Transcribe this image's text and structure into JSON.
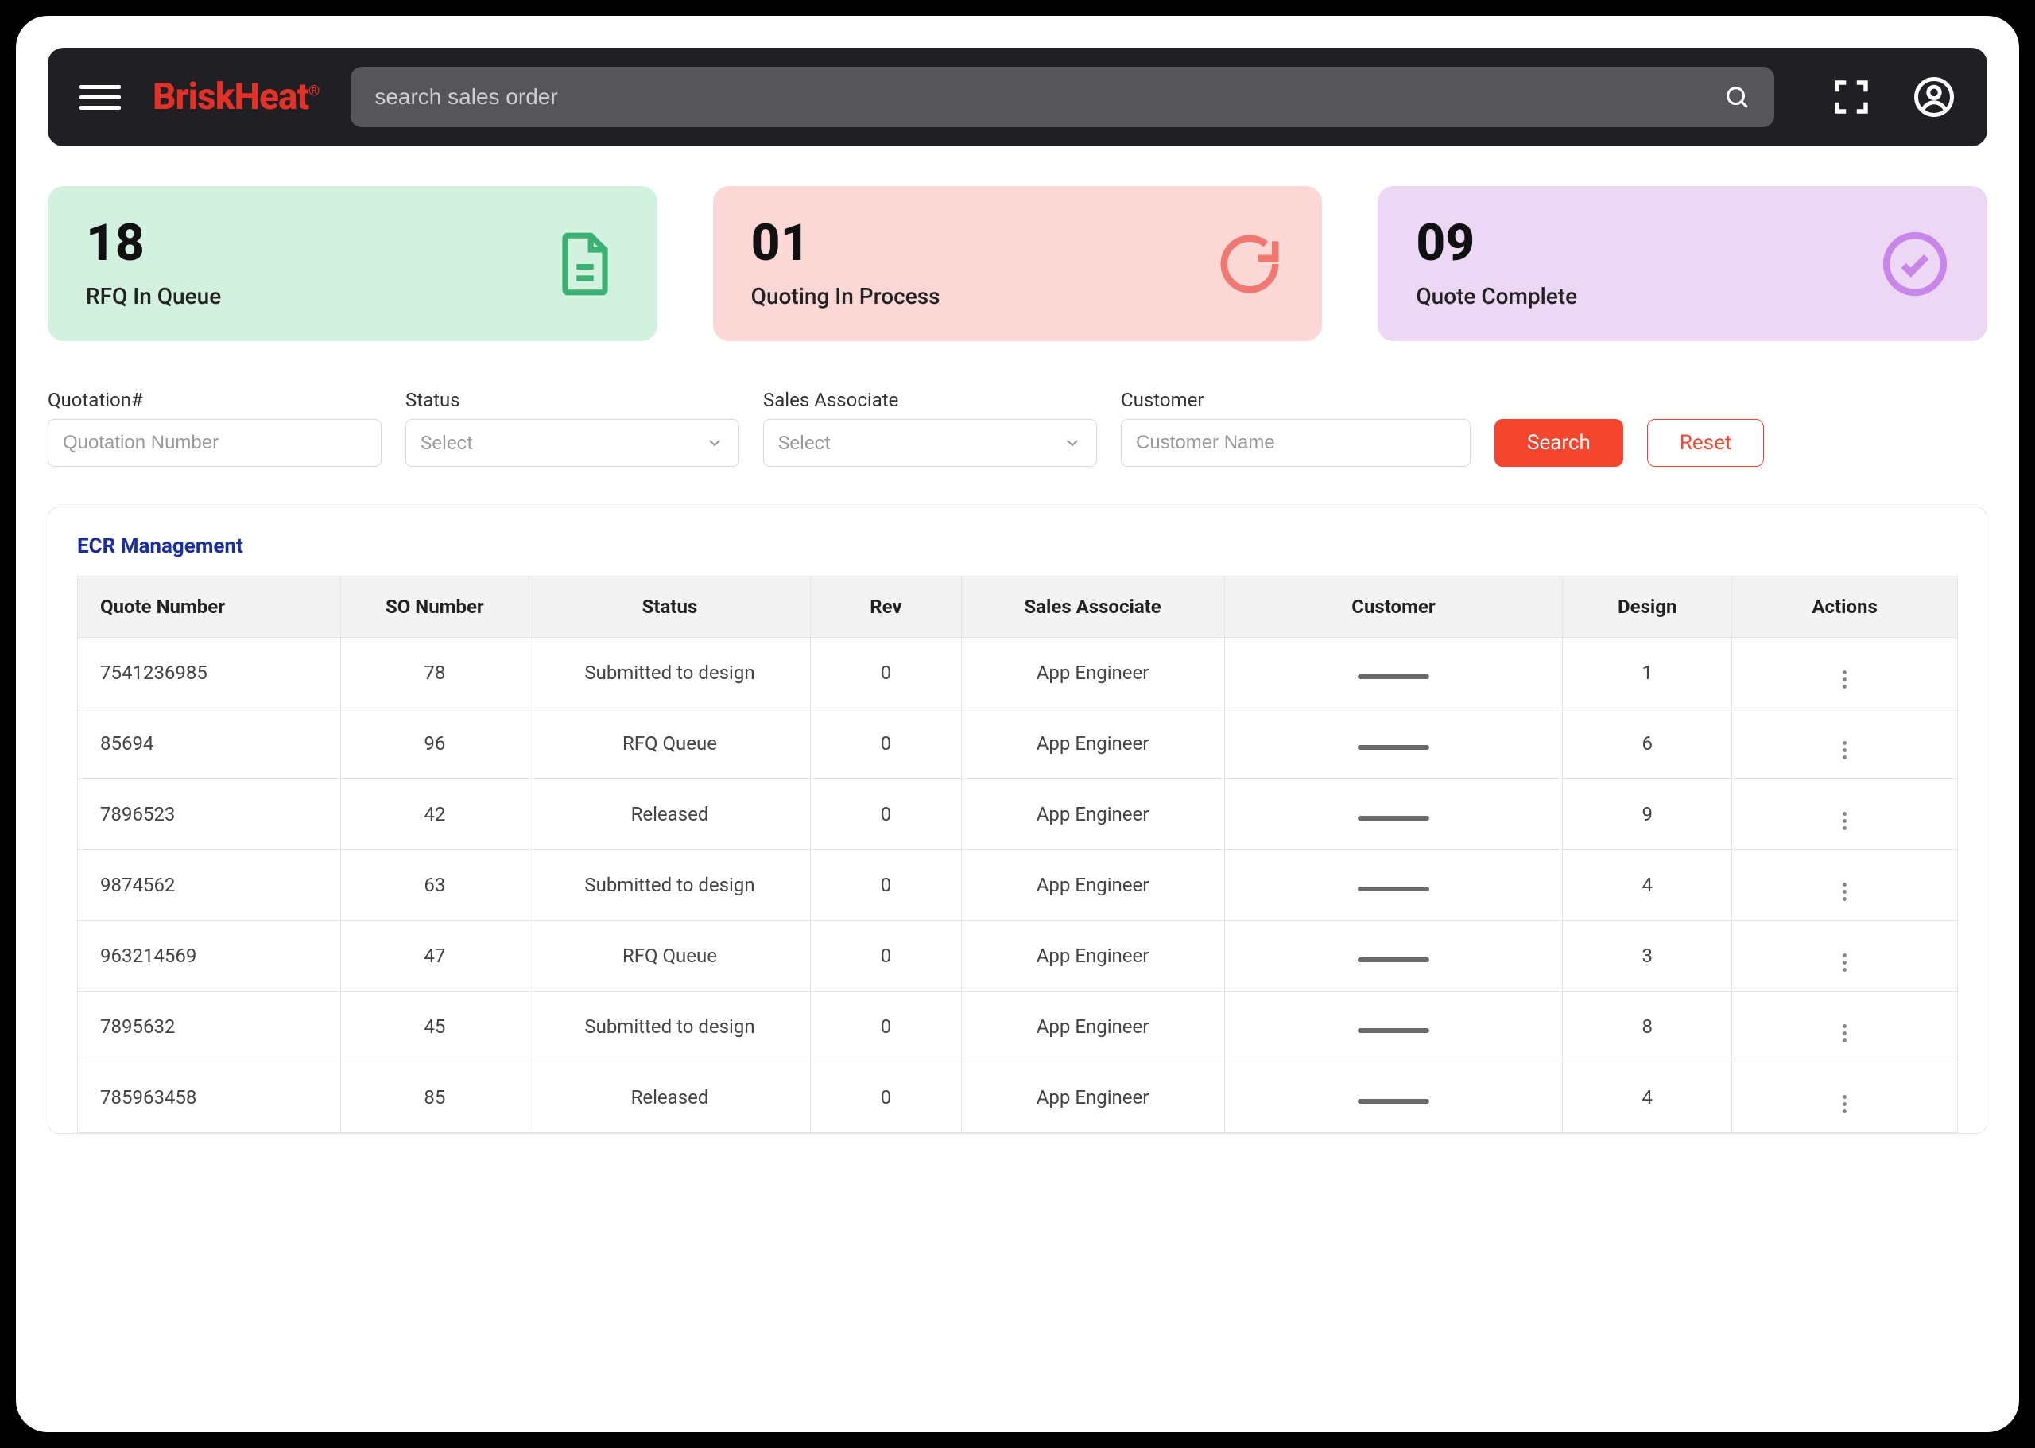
{
  "header": {
    "brand": "BriskHeat",
    "brand_sup": "®",
    "search_placeholder": "search sales order"
  },
  "cards": [
    {
      "value": "18",
      "label": "RFQ In Queue"
    },
    {
      "value": "01",
      "label": "Quoting In Process"
    },
    {
      "value": "09",
      "label": "Quote Complete"
    }
  ],
  "filters": {
    "quotation_label": "Quotation#",
    "quotation_placeholder": "Quotation Number",
    "status_label": "Status",
    "status_placeholder": "Select",
    "associate_label": "Sales Associate",
    "associate_placeholder": "Select",
    "customer_label": "Customer",
    "customer_placeholder": "Customer Name",
    "search_btn": "Search",
    "reset_btn": "Reset"
  },
  "table": {
    "title": "ECR Management",
    "headers": [
      "Quote Number",
      "SO Number",
      "Status",
      "Rev",
      "Sales Associate",
      "Customer",
      "Design",
      "Actions"
    ],
    "rows": [
      {
        "quote": "7541236985",
        "so": "78",
        "status": "Submitted to design",
        "rev": "0",
        "assoc": "App Engineer",
        "design": "1"
      },
      {
        "quote": "85694",
        "so": "96",
        "status": "RFQ Queue",
        "rev": "0",
        "assoc": "App Engineer",
        "design": "6"
      },
      {
        "quote": "7896523",
        "so": "42",
        "status": "Released",
        "rev": "0",
        "assoc": "App Engineer",
        "design": "9"
      },
      {
        "quote": "9874562",
        "so": "63",
        "status": "Submitted to design",
        "rev": "0",
        "assoc": "App Engineer",
        "design": "4"
      },
      {
        "quote": "963214569",
        "so": "47",
        "status": "RFQ Queue",
        "rev": "0",
        "assoc": "App Engineer",
        "design": "3"
      },
      {
        "quote": "7895632",
        "so": "45",
        "status": "Submitted to design",
        "rev": "0",
        "assoc": "App Engineer",
        "design": "8"
      },
      {
        "quote": "785963458",
        "so": "85",
        "status": "Released",
        "rev": "0",
        "assoc": "App Engineer",
        "design": "4"
      }
    ]
  }
}
